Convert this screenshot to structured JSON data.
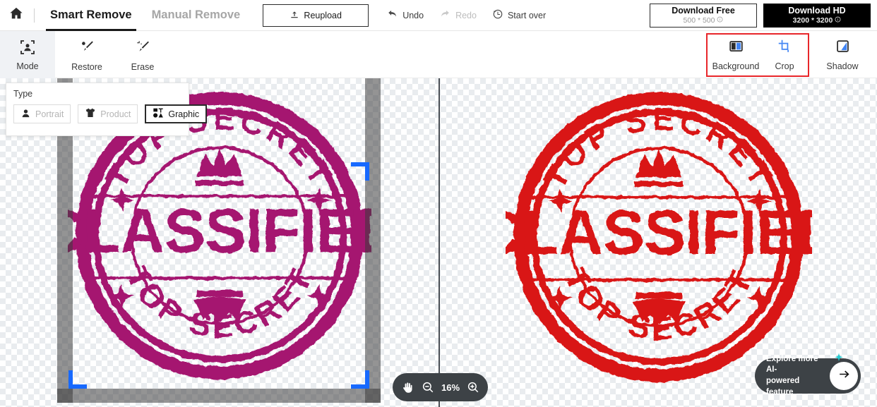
{
  "topbar": {
    "home_icon": "home-icon",
    "tabs": [
      {
        "label": "Smart Remove",
        "active": true
      },
      {
        "label": "Manual Remove",
        "active": false
      }
    ],
    "reupload": {
      "label": "Reupload",
      "icon": "upload-icon"
    },
    "history": [
      {
        "label": "Undo",
        "icon": "undo-arrow-icon",
        "disabled": false
      },
      {
        "label": "Redo",
        "icon": "redo-arrow-icon",
        "disabled": true
      },
      {
        "label": "Start over",
        "icon": "clock-revert-icon",
        "disabled": false
      }
    ],
    "download_free": {
      "title": "Download Free",
      "size": "500 * 500",
      "info_icon": "info-circle-icon"
    },
    "download_hd": {
      "title": "Download HD",
      "size": "3200 * 3200",
      "info_icon": "info-circle-icon"
    }
  },
  "toolbar": {
    "mode": {
      "label": "Mode",
      "icon": "person-frame-icon"
    },
    "restore": {
      "label": "Restore",
      "icon": "restore-brush-icon"
    },
    "erase": {
      "label": "Erase",
      "icon": "erase-wand-icon"
    },
    "background": {
      "label": "Background",
      "icon": "background-split-icon"
    },
    "crop": {
      "label": "Crop",
      "icon": "crop-icon"
    },
    "shadow": {
      "label": "Shadow",
      "icon": "shadow-icon"
    },
    "highlight_color": "#e8262a"
  },
  "type_panel": {
    "title": "Type",
    "options": [
      {
        "label": "Portrait",
        "icon": "portrait-icon",
        "selected": false
      },
      {
        "label": "Product",
        "icon": "tshirt-icon",
        "selected": false
      },
      {
        "label": "Graphic",
        "icon": "graphic-shapes-icon",
        "selected": true
      }
    ]
  },
  "canvas": {
    "left_pane": {
      "name": "processed-preview",
      "stamp": {
        "top_text": "TOP SECRET",
        "center_text": "CLASSIFIED",
        "bottom_text": "TOP SECRET",
        "color": "#a5176f"
      }
    },
    "right_pane": {
      "name": "original-preview",
      "stamp": {
        "top_text": "TOP SECRET",
        "center_text": "CLASSIFIED",
        "bottom_text": "TOP SECRET",
        "color": "#d91414"
      }
    },
    "crop_handle_color": "#1769ff"
  },
  "zoom_control": {
    "pan_icon": "hand-pan-icon",
    "zoom_out_icon": "zoom-out-icon",
    "level": "16%",
    "zoom_in_icon": "zoom-in-icon"
  },
  "explore": {
    "line1": "Explore more AI-",
    "line2": "powered feature",
    "arrow_icon": "arrow-right-icon",
    "sparkle_icon": "sparkle-icon"
  }
}
